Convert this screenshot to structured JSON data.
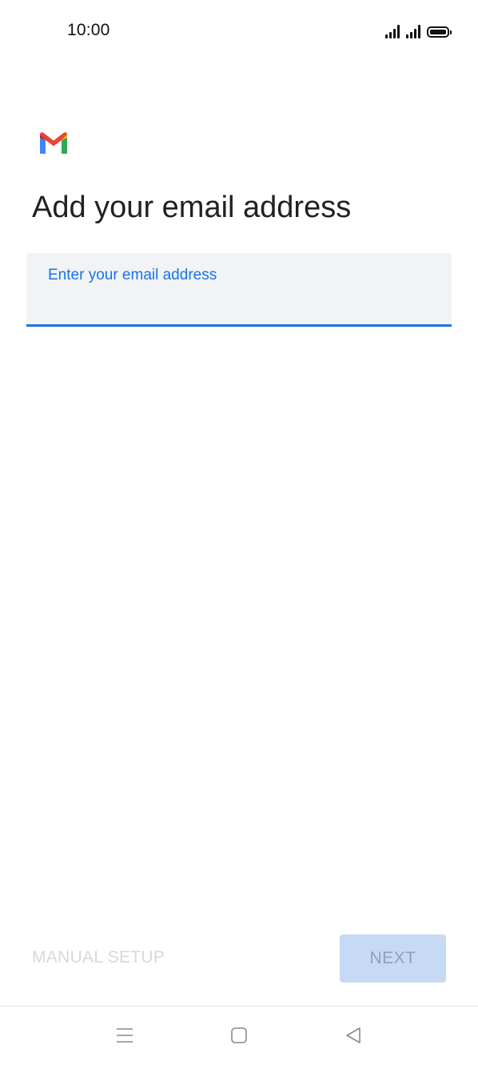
{
  "status_bar": {
    "time": "10:00",
    "icons": [
      "signal-icon",
      "signal-icon",
      "battery-icon"
    ]
  },
  "logo": {
    "icon": "gmail-logo",
    "colors": {
      "blue": "#4285F4",
      "red": "#EA4335",
      "yellow": "#FBBC04",
      "green": "#34A853"
    }
  },
  "page": {
    "title": "Add your email address"
  },
  "email_field": {
    "label": "Enter your email address",
    "value": "",
    "accent_color": "#1a73e8"
  },
  "actions": {
    "manual_setup_label": "MANUAL SETUP",
    "next_label": "NEXT",
    "next_enabled": false
  },
  "nav_bar": {
    "items": [
      "menu-icon",
      "home-icon",
      "back-icon"
    ]
  }
}
